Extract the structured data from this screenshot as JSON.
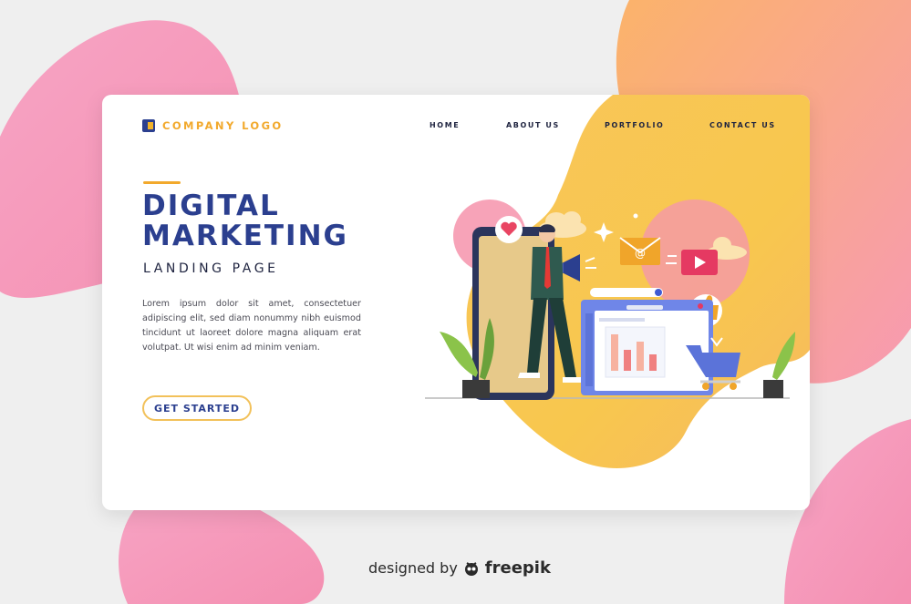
{
  "brand": {
    "logo_text": "COMPANY LOGO"
  },
  "nav": {
    "items": [
      "HOME",
      "ABOUT US",
      "PORTFOLIO",
      "CONTACT US"
    ]
  },
  "hero": {
    "title_line1": "DIGITAL",
    "title_line2": "MARKETING",
    "subtitle": "LANDING PAGE",
    "body": "Lorem ipsum dolor sit amet, consectetuer adipiscing elit, sed diam nonummy nibh euismod tincidunt ut laoreet dolore magna aliquam erat volutpat. Ut wisi enim ad minim veniam.",
    "cta_label": "GET STARTED"
  },
  "illustration": {
    "email_symbol": "@",
    "icons": [
      "heart-icon",
      "megaphone-icon",
      "email-icon",
      "video-play-icon",
      "thumbs-up-icon",
      "search-icon",
      "shopping-cart-icon",
      "bar-chart-icon"
    ]
  },
  "footer": {
    "credit_prefix": "designed by",
    "credit_brand": "freepik"
  },
  "colors": {
    "brand_blue": "#2b3f8f",
    "accent_orange": "#f2a92c",
    "yellow": "#f8c84c",
    "pink": "#f49ab8"
  }
}
